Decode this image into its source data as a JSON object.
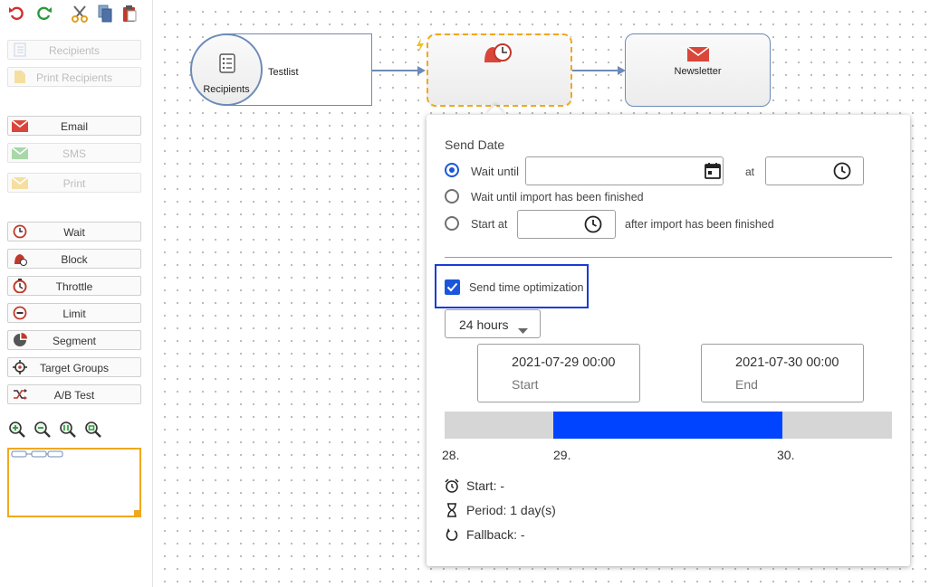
{
  "sidebar": {
    "toolbar": [
      {
        "name": "undo-icon"
      },
      {
        "name": "redo-icon"
      },
      {
        "name": "scissors-icon"
      },
      {
        "name": "copy-icon"
      },
      {
        "name": "paste-icon"
      }
    ],
    "groups": [
      {
        "items": [
          {
            "label": "Recipients",
            "icon": "recipients-icon",
            "disabled": true
          },
          {
            "label": "Print Recipients",
            "icon": "print-recipients-icon",
            "disabled": true
          }
        ]
      },
      {
        "items": [
          {
            "label": "Email",
            "icon": "email-icon",
            "disabled": false
          },
          {
            "label": "SMS",
            "icon": "sms-icon",
            "disabled": true
          },
          {
            "label": "Print",
            "icon": "print-icon",
            "disabled": true
          }
        ]
      },
      {
        "items": [
          {
            "label": "Wait",
            "icon": "wait-icon",
            "disabled": false
          },
          {
            "label": "Block",
            "icon": "block-icon",
            "disabled": false
          },
          {
            "label": "Throttle",
            "icon": "throttle-icon",
            "disabled": false
          },
          {
            "label": "Limit",
            "icon": "limit-icon",
            "disabled": false
          },
          {
            "label": "Segment",
            "icon": "segment-icon",
            "disabled": false
          },
          {
            "label": "Target Groups",
            "icon": "target-groups-icon",
            "disabled": false
          },
          {
            "label": "A/B Test",
            "icon": "ab-test-icon",
            "disabled": false
          }
        ]
      }
    ],
    "zoom": [
      "zoom-in-icon",
      "zoom-out-icon",
      "zoom-fit-icon",
      "zoom-reset-icon"
    ]
  },
  "flow": {
    "recipients_node": {
      "title": "Recipients",
      "list": "Testlist"
    },
    "wait_node": {
      "icon": "block-wait-icon"
    },
    "newsletter_node": {
      "title": "Newsletter",
      "icon": "envelope-icon"
    }
  },
  "popup": {
    "send_date_label": "Send Date",
    "wait_until_label": "Wait until",
    "wait_until_date_value": "",
    "at_label": "at",
    "at_time_value": "",
    "wait_import_label": "Wait until import has been finished",
    "start_at_label": "Start at",
    "start_at_value": "",
    "after_import_label": "after import has been finished",
    "selected_option": "wait_until",
    "sto_label": "Send time optimization",
    "sto_checked": true,
    "period_selected": "24 hours",
    "start_date": "2021-07-29 00:00",
    "start_caption": "Start",
    "end_date": "2021-07-30 00:00",
    "end_caption": "End",
    "timeline_ticks": [
      "28.",
      "29.",
      "30."
    ],
    "info_start": "Start: -",
    "info_period": "Period: 1 day(s)",
    "info_fallback": "Fallback: -"
  },
  "colors": {
    "accent": "#1a56db",
    "timeline_fill": "#0044ff",
    "selection": "#f0a81c",
    "node_border": "#6d8ab8",
    "highlight_box": "#1a3bd8"
  }
}
